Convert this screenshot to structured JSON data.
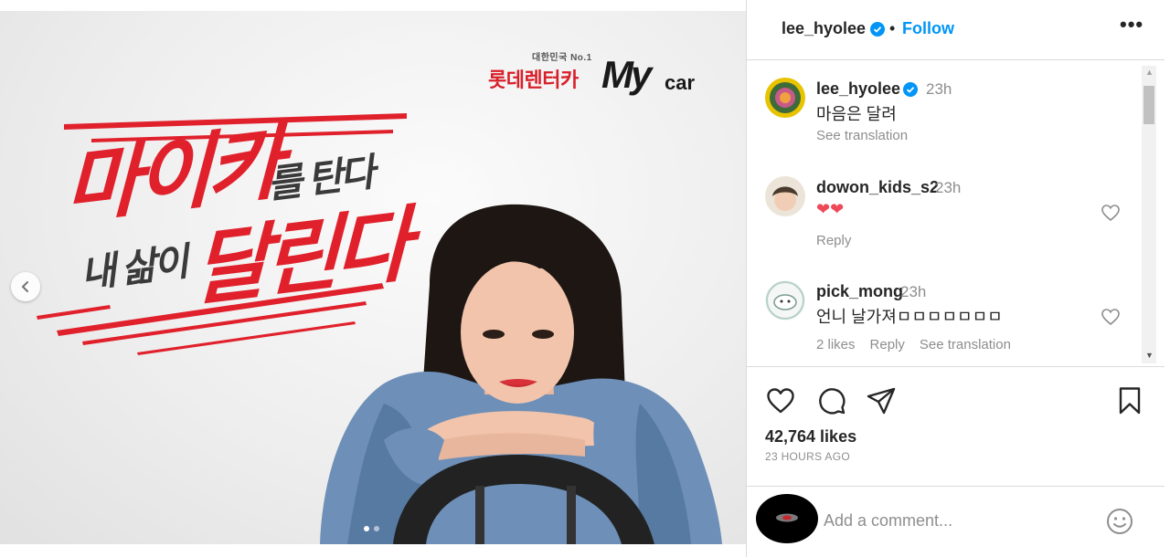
{
  "post_image": {
    "brand_sub": "대한민국 No.1",
    "brand_korean": "롯데렌터카",
    "brand_my": "My",
    "brand_car": "car",
    "headline_big_1": "마이카",
    "headline_small_1": "를 탄다",
    "headline_small_2": "내 삶이",
    "headline_big_2": "달린다",
    "carousel_dots": 2,
    "active_dot": 1
  },
  "header": {
    "username": "lee_hyolee",
    "separator": "•",
    "follow_label": "Follow",
    "more_label": "•••"
  },
  "comments": [
    {
      "username": "lee_hyolee",
      "verified": true,
      "time": "23h",
      "text": "마음은 달려",
      "meta": [
        "See translation"
      ],
      "likeable": false
    },
    {
      "username": "dowon_kids_s2",
      "verified": false,
      "time": "23h",
      "text": "❤❤",
      "meta": [
        "Reply"
      ],
      "likeable": true
    },
    {
      "username": "pick_mong",
      "verified": false,
      "time": "23h",
      "text": "언니 날가져ㅁㅁㅁㅁㅁㅁㅁ",
      "meta": [
        "2 likes",
        "Reply",
        "See translation"
      ],
      "likeable": true
    }
  ],
  "stats": {
    "likes": "42,764 likes",
    "time_ago": "23 HOURS AGO"
  },
  "add_comment": {
    "placeholder": "Add a comment..."
  },
  "colors": {
    "accent_blue": "#0095f6",
    "brand_red": "#e0212c",
    "heart_red": "#ed4956"
  },
  "icons": [
    "chevron-left-icon",
    "more-icon",
    "verified-badge-icon",
    "heart-icon",
    "comment-icon",
    "share-icon",
    "bookmark-icon",
    "emoji-icon"
  ]
}
